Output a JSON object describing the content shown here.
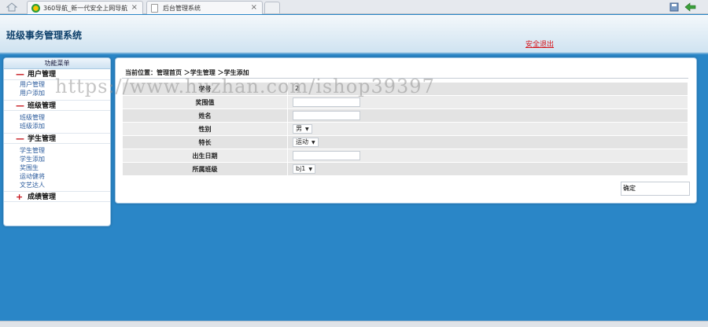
{
  "browser": {
    "tabs": [
      {
        "label": "360导航_新一代安全上网导航",
        "close": "×"
      },
      {
        "label": "后台管理系统",
        "close": "×"
      }
    ]
  },
  "header": {
    "title": "班级事务管理系统",
    "logout": "安全退出"
  },
  "menu": {
    "title": "功能菜单",
    "groups": [
      {
        "sign": "—",
        "label": "用户管理",
        "items": [
          "用户管理",
          "用户添加"
        ]
      },
      {
        "sign": "—",
        "label": "班级管理",
        "items": [
          "班级管理",
          "班级添加"
        ]
      },
      {
        "sign": "—",
        "label": "学生管理",
        "items": [
          "学生管理",
          "学生添加",
          "奖围生",
          "运动健将",
          "文艺达人"
        ]
      },
      {
        "sign": "+",
        "label": "成绩管理",
        "items": []
      }
    ]
  },
  "breadcrumb": "当前位置：管理首页 ＞学生管理 ＞学生添加",
  "form": {
    "rows": [
      {
        "label": "学号",
        "type": "text",
        "value": "2"
      },
      {
        "label": "奖围值",
        "type": "text",
        "value": ""
      },
      {
        "label": "姓名",
        "type": "text",
        "value": ""
      },
      {
        "label": "性别",
        "type": "select",
        "value": "男"
      },
      {
        "label": "特长",
        "type": "select",
        "value": "运动"
      },
      {
        "label": "出生日期",
        "type": "text",
        "value": ""
      },
      {
        "label": "所属班级",
        "type": "select",
        "value": "bj1"
      }
    ],
    "submit": "确定"
  },
  "watermark": "https://www.huzhan.com/ishop39397",
  "colors": {
    "background": "#2a86c7",
    "logout": "#d6141a",
    "title": "#0d3f6a"
  }
}
